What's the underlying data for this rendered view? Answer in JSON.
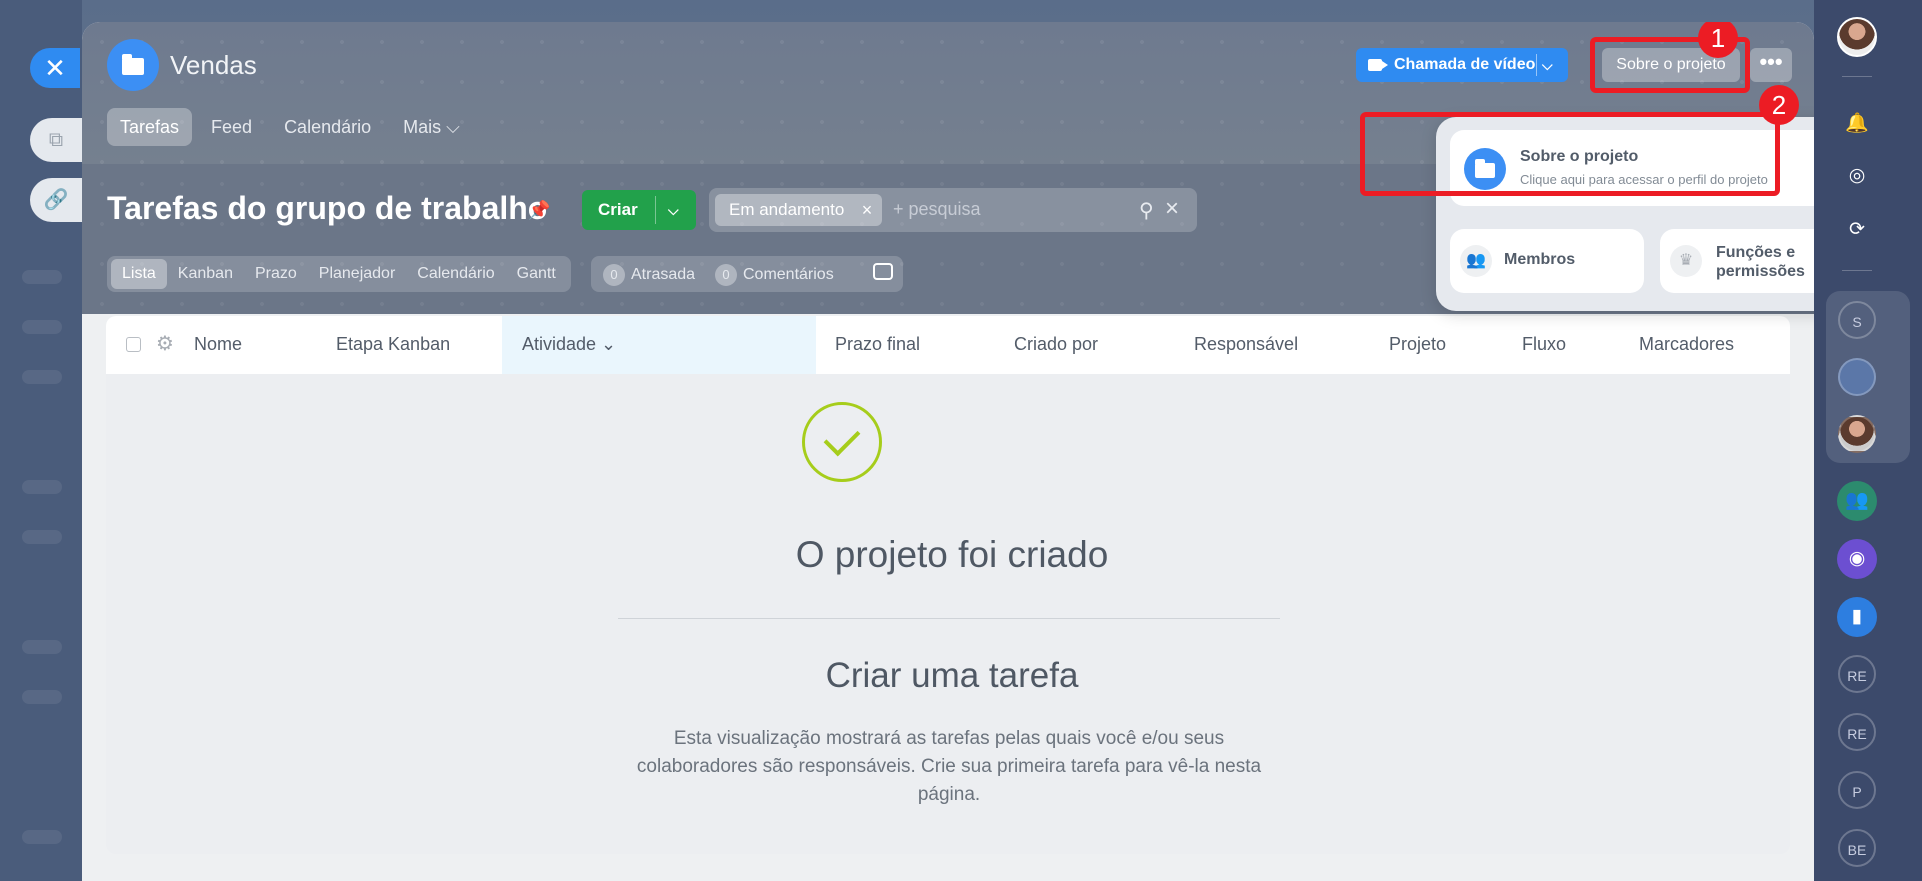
{
  "project": {
    "title": "Vendas",
    "nav": [
      "Tarefas",
      "Feed",
      "Calendário",
      "Mais ⌵"
    ],
    "nav_active": "Tarefas"
  },
  "header_actions": {
    "video_call_label": "Chamada de vídeo",
    "about_label": "Sobre o projeto",
    "more_label": "•••"
  },
  "callouts": [
    "1",
    "2"
  ],
  "page": {
    "title": "Tarefas do grupo de trabalho",
    "create_label": "Criar"
  },
  "search": {
    "filter_chip": "Em andamento",
    "placeholder": "+ pesquisa"
  },
  "views": {
    "items": [
      "Lista",
      "Kanban",
      "Prazo",
      "Planejador",
      "Calendário",
      "Gantt"
    ],
    "active": "Lista"
  },
  "counters": [
    {
      "count": "0",
      "label": "Atrasada"
    },
    {
      "count": "0",
      "label": "Comentários"
    }
  ],
  "popup": {
    "about": {
      "title": "Sobre o projeto",
      "subtitle": "Clique aqui para acessar o perfil do projeto"
    },
    "members": {
      "title": "Membros"
    },
    "roles": {
      "title": "Funções e permissões"
    }
  },
  "grid": {
    "columns": [
      "Nome",
      "Etapa Kanban",
      "Atividade ⌄",
      "Prazo final",
      "Criado por",
      "Responsável",
      "Projeto",
      "Fluxo",
      "Marcadores"
    ],
    "sorted_column": "Atividade"
  },
  "empty_state": {
    "title": "O projeto foi criado",
    "subtitle": "Criar uma tarefa",
    "description": "Esta visualização mostrará as tarefas pelas quais você e/ou seus colaboradores são responsáveis. Crie sua primeira tarefa para vê-la nesta página."
  },
  "rail": {
    "avatars": [
      "S",
      "RE",
      "RE",
      "P",
      "BE"
    ]
  },
  "colors": {
    "accent_blue": "#2f8bf1",
    "create_green": "#22a14b",
    "highlight_red": "#ec1c24",
    "success_green": "#a6cd1b"
  }
}
